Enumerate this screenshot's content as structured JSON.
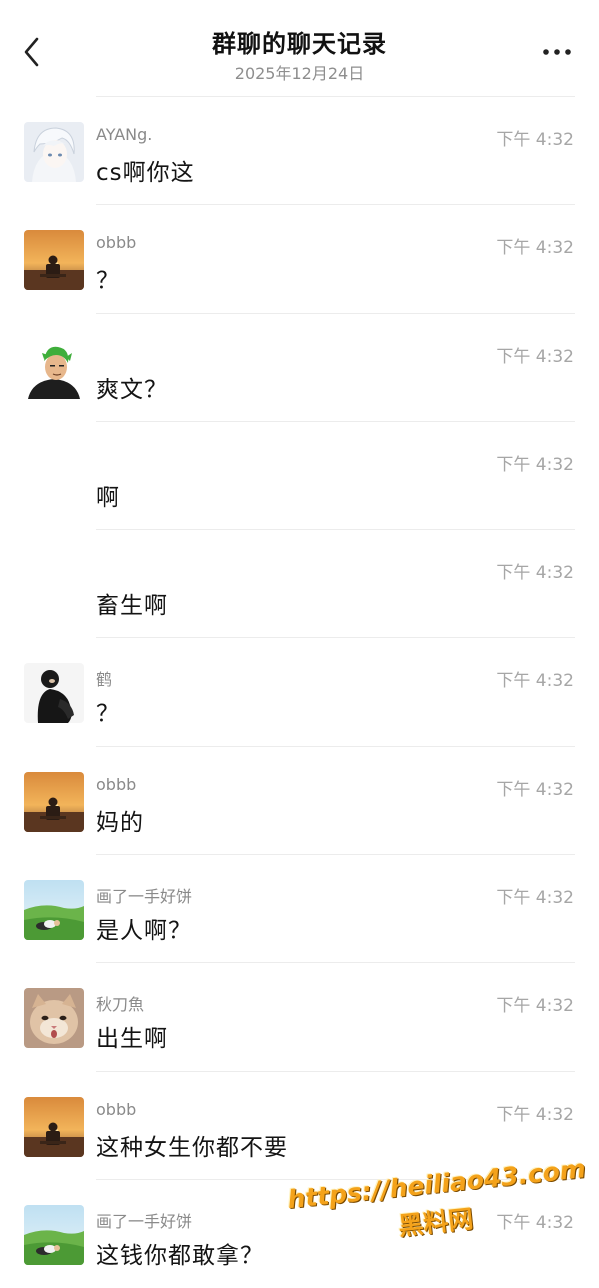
{
  "header": {
    "title": "群聊的聊天记录",
    "date": "2025年12月24日"
  },
  "messages": [
    {
      "name": "AYANg.",
      "time": "下午 4:32",
      "text": "cs啊你这",
      "avatar": "white-hair-anime-avatar"
    },
    {
      "name": "obbb",
      "time": "下午 4:32",
      "text": "？",
      "avatar": "sunset-avatar"
    },
    {
      "name": "",
      "time": "下午 4:32",
      "text": "爽文？",
      "avatar": "green-hair-anime-avatar"
    },
    {
      "name": "",
      "time": "下午 4:32",
      "text": "啊",
      "avatar": ""
    },
    {
      "name": "",
      "time": "下午 4:32",
      "text": "畜生啊",
      "avatar": ""
    },
    {
      "name": "鹤",
      "time": "下午 4:32",
      "text": "？",
      "avatar": "dark-figure-avatar"
    },
    {
      "name": "obbb",
      "time": "下午 4:32",
      "text": "妈的",
      "avatar": "sunset-avatar"
    },
    {
      "name": "画了一手好饼",
      "time": "下午 4:32",
      "text": "是人啊？",
      "avatar": "green-field-avatar"
    },
    {
      "name": "秋刀魚",
      "time": "下午 4:32",
      "text": "出生啊",
      "avatar": "cat-avatar"
    },
    {
      "name": "obbb",
      "time": "下午 4:32",
      "text": "这种女生你都不要",
      "avatar": "sunset-avatar"
    },
    {
      "name": "画了一手好饼",
      "time": "下午 4:32",
      "text": "这钱你都敢拿？",
      "avatar": "green-field-avatar"
    }
  ],
  "watermark": {
    "url": "https://heiliao43.com",
    "label": "黑料网"
  },
  "icons": {
    "back": "chevron-left-icon",
    "more": "more-dots-icon"
  },
  "colors": {
    "name": "#8a8a8a",
    "time": "#a6a6a6",
    "watermark": "#f4a21a"
  }
}
